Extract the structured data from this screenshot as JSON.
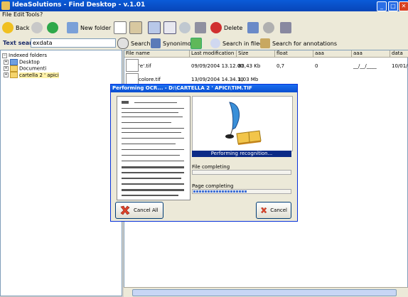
{
  "window": {
    "title": "IdeaSolutions - Find Desktop - v.1.01"
  },
  "menu": [
    "File",
    "Edit",
    "Tools",
    "?"
  ],
  "toolbar": {
    "back": "Back",
    "new_folder": "New folder",
    "delete": "Delete"
  },
  "search": {
    "label": "Text search",
    "value": "exdata",
    "search": "Search",
    "synonymous": "Synonimous",
    "search_fields": "Search in fileds",
    "search_annotations": "Search for annotations"
  },
  "tree": {
    "root": "Indexed folders",
    "items": [
      "Desktop",
      "Documenti",
      "cartella 2 ' apici"
    ]
  },
  "list": {
    "columns": [
      "File name",
      "Last modification d...",
      "Size",
      "float",
      "aaa",
      "aaa",
      "data"
    ],
    "rows": [
      [
        "'e'.tif",
        "09/09/2004 13.12.00",
        "83,43 Kb",
        "0,7",
        "0",
        "__/__/____",
        "10/01/20"
      ],
      [
        "colore.tif",
        "13/09/2004 14.34.10",
        "1,03 Mb",
        "",
        "",
        "",
        ""
      ]
    ]
  },
  "dialog": {
    "title": "Performing OCR... - D:\\CARTELLA 2 ' APICI\\TIM.TIF",
    "status": "Performing recognition...",
    "file_label": "File completing",
    "file_progress": 0,
    "page_label": "Page completing",
    "page_progress": 0.55,
    "cancel_all": "Cancel All",
    "cancel": "Cancel"
  }
}
